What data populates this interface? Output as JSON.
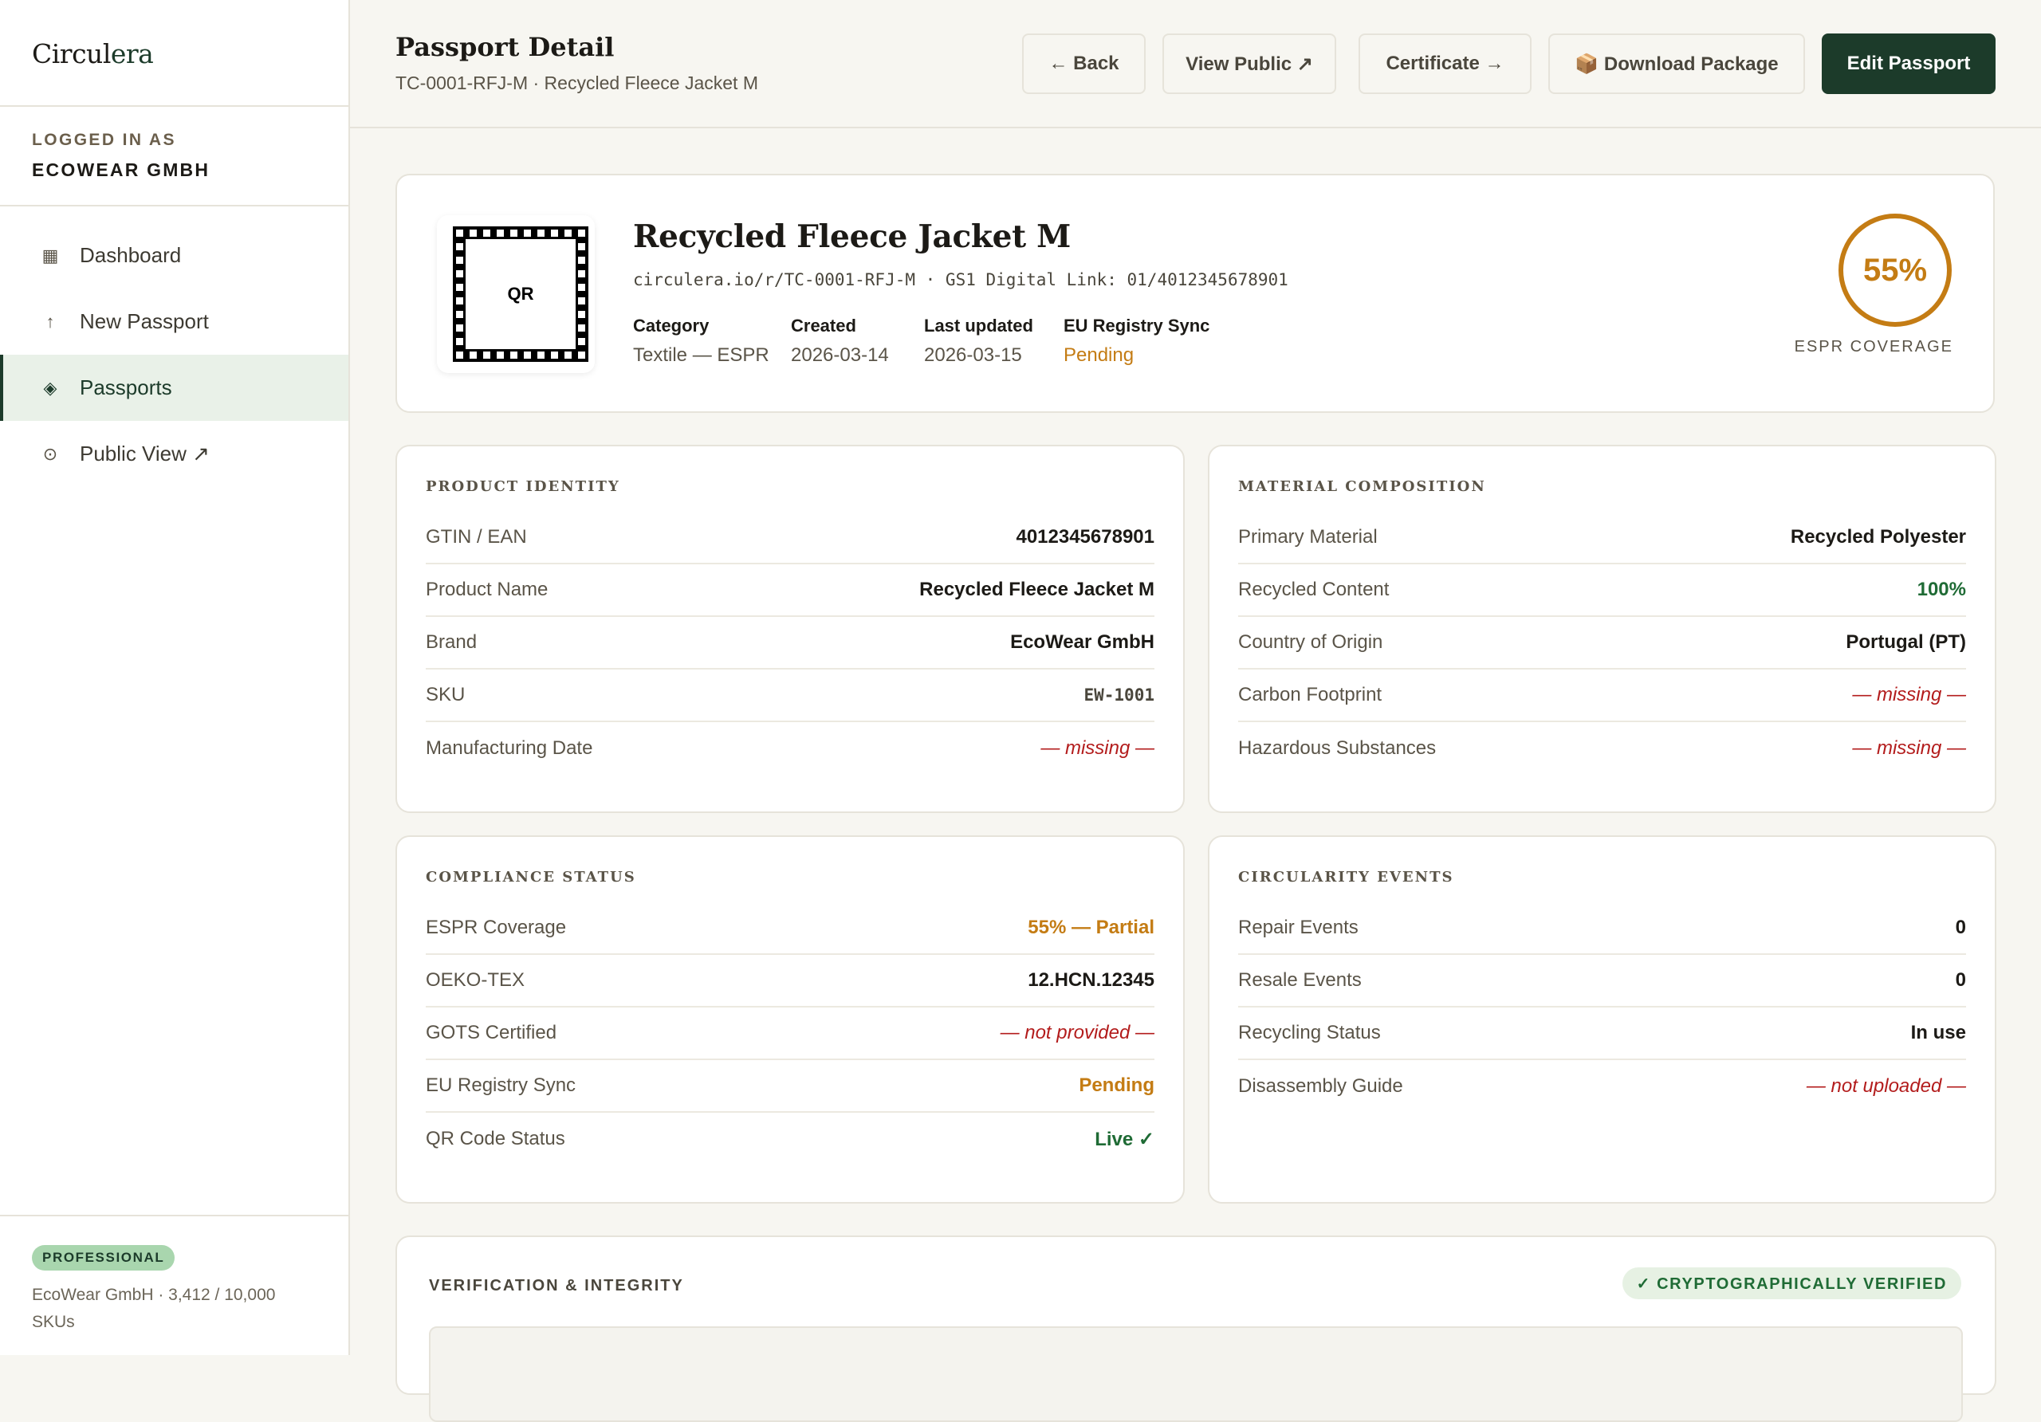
{
  "app": {
    "logo_main": "Circul",
    "logo_accent": "era"
  },
  "account": {
    "label": "LOGGED IN AS",
    "name": "ECOWEAR GMBH"
  },
  "nav": [
    {
      "icon": "▦",
      "label": "Dashboard"
    },
    {
      "icon": "↑",
      "label": "New Passport"
    },
    {
      "icon": "◈",
      "label": "Passports"
    },
    {
      "icon": "⊙",
      "label": "Public View ↗"
    }
  ],
  "plan": {
    "badge": "PROFESSIONAL",
    "meta": "EcoWear GmbH · 3,412 / 10,000 SKUs"
  },
  "header": {
    "title": "Passport Detail",
    "subtitle": "TC-0001-RFJ-M · Recycled Fleece Jacket M",
    "buttons": {
      "back": "← Back",
      "view_public": "View Public ↗",
      "certificate": "Certificate →",
      "download": "📦 Download Package",
      "edit": "Edit Passport"
    }
  },
  "hero": {
    "qr_label": "QR",
    "title": "Recycled Fleece Jacket M",
    "link": "circulera.io/r/TC-0001-RFJ-M · GS1 Digital Link: 01/4012345678901",
    "meta": [
      {
        "key": "Category",
        "value": "Textile — ESPR"
      },
      {
        "key": "Created",
        "value": "2026-03-14"
      },
      {
        "key": "Last updated",
        "value": "2026-03-15"
      },
      {
        "key": "EU Registry Sync",
        "value": "Pending"
      }
    ],
    "coverage": {
      "value": "55%",
      "label": "ESPR COVERAGE",
      "fraction": 0.55,
      "color": "#c47c14"
    }
  },
  "product_identity": {
    "title": "PRODUCT IDENTITY",
    "rows": [
      {
        "key": "GTIN / EAN",
        "value": "4012345678901"
      },
      {
        "key": "Product Name",
        "value": "Recycled Fleece Jacket M"
      },
      {
        "key": "Brand",
        "value": "EcoWear GmbH"
      },
      {
        "key": "SKU",
        "value": "EW-1001"
      },
      {
        "key": "Manufacturing Date",
        "value": "— missing —"
      }
    ]
  },
  "material_composition": {
    "title": "MATERIAL COMPOSITION",
    "rows": [
      {
        "key": "Primary Material",
        "value": "Recycled Polyester"
      },
      {
        "key": "Recycled Content",
        "value": "100%"
      },
      {
        "key": "Country of Origin",
        "value": "Portugal (PT)"
      },
      {
        "key": "Carbon Footprint",
        "value": "— missing —"
      },
      {
        "key": "Hazardous Substances",
        "value": "— missing —"
      }
    ]
  },
  "compliance_status": {
    "title": "COMPLIANCE STATUS",
    "rows": [
      {
        "key": "ESPR Coverage",
        "value": "55% — Partial"
      },
      {
        "key": "OEKO-TEX",
        "value": "12.HCN.12345"
      },
      {
        "key": "GOTS Certified",
        "value": "— not provided —"
      },
      {
        "key": "EU Registry Sync",
        "value": "Pending"
      },
      {
        "key": "QR Code Status",
        "value": "Live ✓"
      }
    ]
  },
  "circularity_events": {
    "title": "CIRCULARITY EVENTS",
    "rows": [
      {
        "key": "Repair Events",
        "value": "0"
      },
      {
        "key": "Resale Events",
        "value": "0"
      },
      {
        "key": "Recycling Status",
        "value": "In use"
      },
      {
        "key": "Disassembly Guide",
        "value": "— not uploaded —"
      }
    ]
  },
  "verification": {
    "title": "VERIFICATION & INTEGRITY",
    "badge": "✓ CRYPTOGRAPHICALLY VERIFIED"
  },
  "colors": {
    "brand": "#1c3b2a",
    "warning": "#c47c14",
    "missing": "#b31c1c",
    "success": "#1f6b35"
  }
}
